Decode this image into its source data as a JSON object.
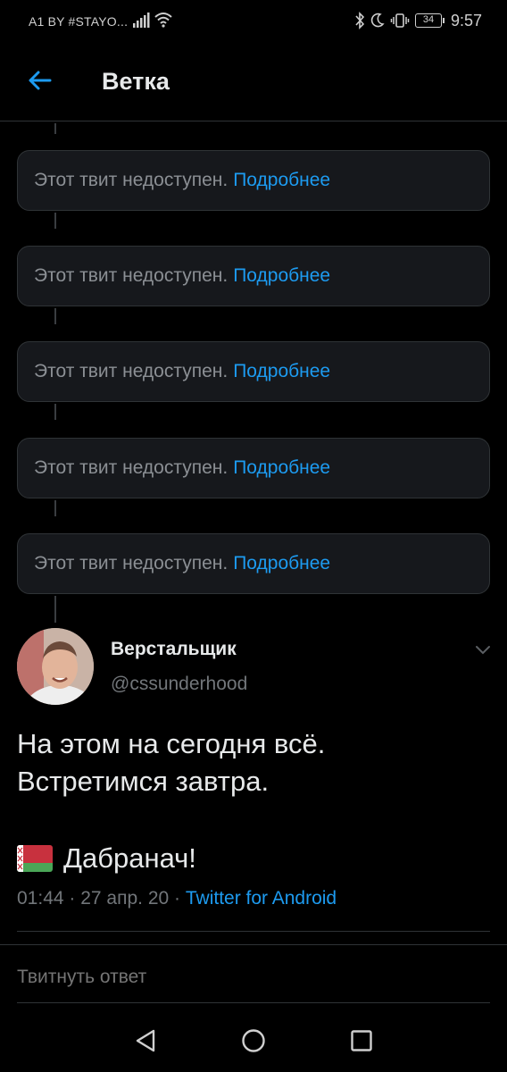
{
  "status_bar": {
    "carrier": "A1 BY #STAYO...",
    "battery": "34",
    "time": "9:57"
  },
  "header": {
    "title": "Ветка",
    "back_icon": "arrow-left-icon"
  },
  "unavailable_tweets": [
    {
      "text": "Этот твит недоступен.",
      "link": "Подробнее"
    },
    {
      "text": "Этот твит недоступен.",
      "link": "Подробнее"
    },
    {
      "text": "Этот твит недоступен.",
      "link": "Подробнее"
    },
    {
      "text": "Этот твит недоступен.",
      "link": "Подробнее"
    },
    {
      "text": "Этот твит недоступен.",
      "link": "Подробнее"
    }
  ],
  "tweet": {
    "author_name": "Верстальщик",
    "author_handle": "@cssunderhood",
    "text_line1": "На этом на сегодня всё.",
    "text_line2": "Встретимся завтра.",
    "text_line3": "Дабранач!",
    "time": "01:44",
    "date": "27 апр. 20",
    "source": "Twitter for Android",
    "meta_separator": " · "
  },
  "reply": {
    "placeholder": "Твитнуть ответ"
  },
  "colors": {
    "background": "#000000",
    "accent": "#1d9bf0",
    "card": "#16181c",
    "border": "#2f3336",
    "muted": "#72767a"
  }
}
